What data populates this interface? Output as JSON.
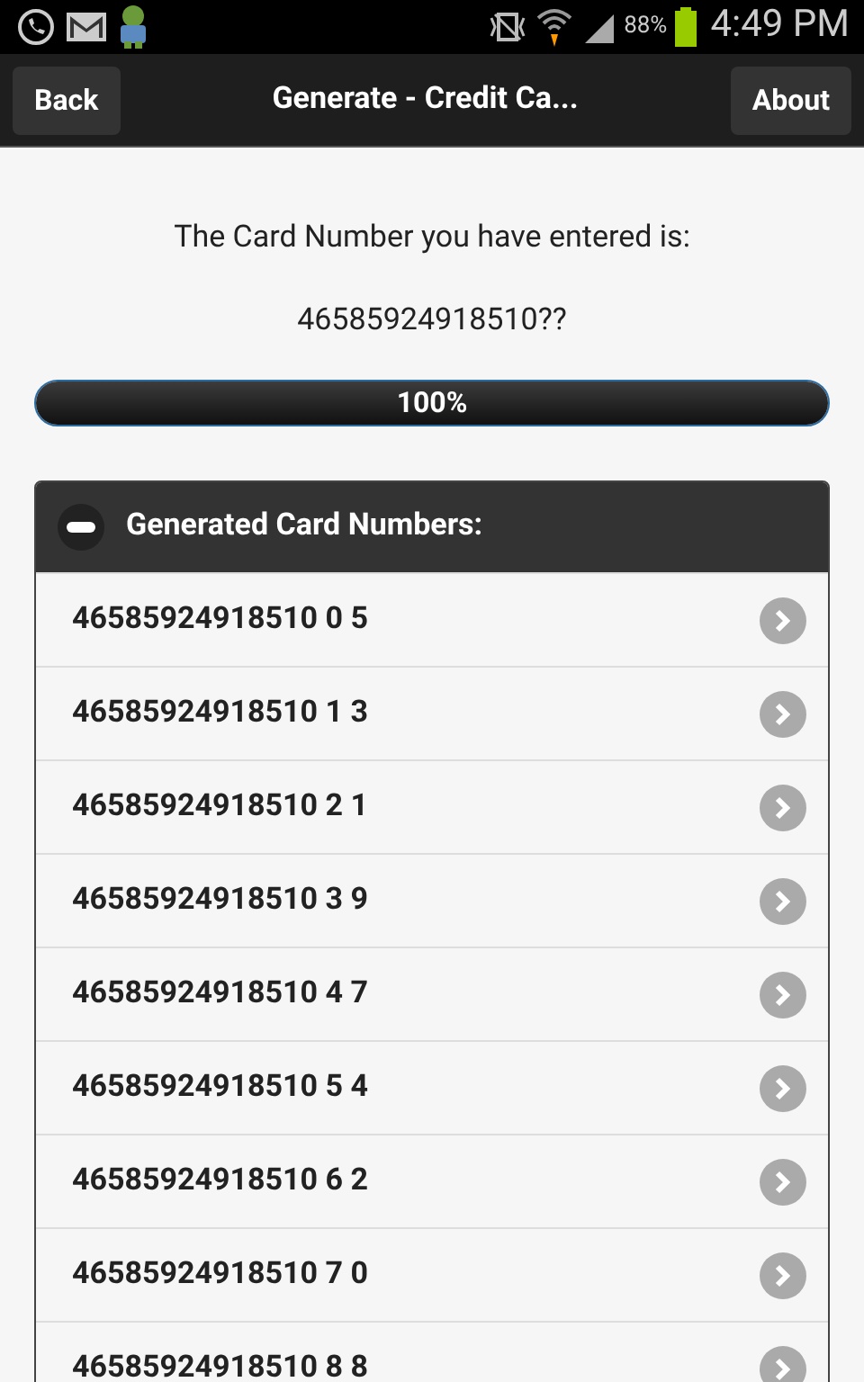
{
  "status_bar": {
    "battery": "88%",
    "time": "4:49 PM"
  },
  "header": {
    "back": "Back",
    "title": "Generate - Credit Ca...",
    "about": "About"
  },
  "intro": "The Card Number you have entered is:",
  "entered_number": "46585924918510??",
  "progress": {
    "level": 1,
    "label": "100%"
  },
  "results": {
    "title": "Generated Card Numbers:",
    "expanded": true,
    "items": [
      {
        "number": "46585924918510 0 5"
      },
      {
        "number": "46585924918510 1 3"
      },
      {
        "number": "46585924918510 2 1"
      },
      {
        "number": "46585924918510 3 9"
      },
      {
        "number": "46585924918510 4 7"
      },
      {
        "number": "46585924918510 5 4"
      },
      {
        "number": "46585924918510 6 2"
      },
      {
        "number": "46585924918510 7 0"
      },
      {
        "number": "46585924918510 8 8"
      }
    ]
  }
}
